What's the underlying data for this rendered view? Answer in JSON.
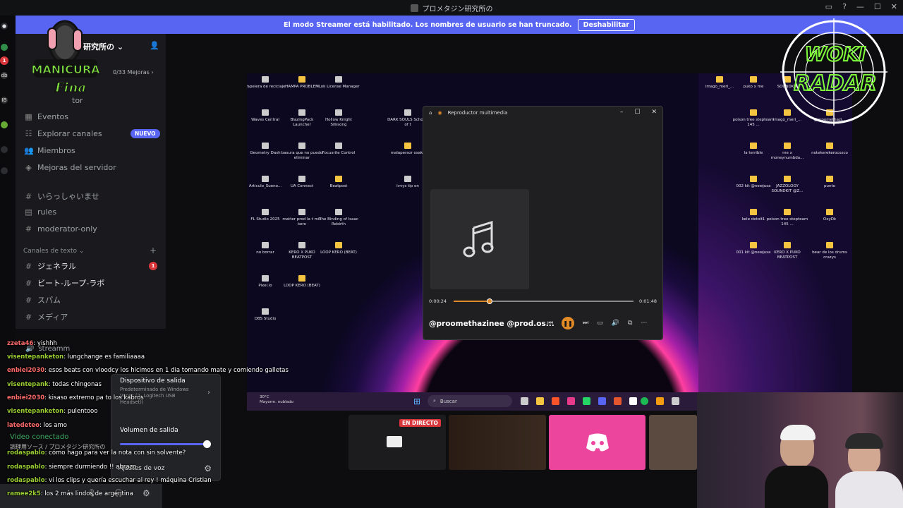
{
  "titlebar": {
    "title": "プロメタジン研究所の"
  },
  "banner": {
    "text": "El modo Streamer está habilitado. Los nombres de usuario se han truncado.",
    "button": "Deshabilitar"
  },
  "rail": {
    "labels": [
      "db",
      "IB"
    ],
    "badge": "1"
  },
  "sidebar": {
    "server_name": "研究所の",
    "boost": "0/33 Mejoras",
    "items": [
      {
        "label": "tor"
      },
      {
        "label": "Eventos"
      },
      {
        "label": "Explorar canales",
        "badge": "NUEVO"
      },
      {
        "label": "Miembros"
      },
      {
        "label": "Mejoras del servidor"
      },
      {
        "label": "いらっしゃいませ"
      },
      {
        "label": "rules"
      },
      {
        "label": "moderator-only"
      }
    ],
    "category": "Canales de texto",
    "text_channels": [
      {
        "label": "ジェネラル",
        "badge": "1"
      },
      {
        "label": "ビート-ループ-ラボ"
      },
      {
        "label": "スパム"
      },
      {
        "label": "メディア"
      },
      {
        "label": "streamm"
      }
    ]
  },
  "logo": {
    "line1": "MANICURA",
    "line2": "Fina"
  },
  "radar": {
    "line1": "WOKI",
    "line2": "RADAR"
  },
  "desktop": {
    "icons_left": [
      {
        "label": "Papelera de reciclaje",
        "type": "app"
      },
      {
        "label": "HAMPA PROBLEM",
        "type": "folder"
      },
      {
        "label": "iLok License Manager",
        "type": "app"
      },
      {
        "label": "Waves Central",
        "type": "app"
      },
      {
        "label": "BlazingPack Launcher",
        "type": "app"
      },
      {
        "label": "Hollow Knight Silksong",
        "type": "app"
      },
      {
        "label": "DARK SOULS Scholar of t",
        "type": "app"
      },
      {
        "label": "Geometry Dash",
        "type": "app"
      },
      {
        "label": "basura que no puedo eliminar",
        "type": "app"
      },
      {
        "label": "Focusrite Control",
        "type": "app"
      },
      {
        "label": "malapersor osaka",
        "type": "folder"
      },
      {
        "label": "Articulo_Sueno...",
        "type": "app"
      },
      {
        "label": "UA Connect",
        "type": "app"
      },
      {
        "label": "Beatpost",
        "type": "folder"
      },
      {
        "label": "ivvys tip on",
        "type": "app"
      },
      {
        "label": "FL Studio 2025",
        "type": "app"
      },
      {
        "label": "matter prod la t mix kero",
        "type": "app"
      },
      {
        "label": "The Binding of Isaac Rebirth",
        "type": "app"
      },
      {
        "label": "no borrar",
        "type": "app"
      },
      {
        "label": "KERO X PUKO BEATPOST",
        "type": "app"
      },
      {
        "label": "LOOP KERO (BEAT)",
        "type": "folder"
      },
      {
        "label": "Pixel.io",
        "type": "app"
      },
      {
        "label": "LOOP KERO (BEAT)",
        "type": "folder"
      },
      {
        "label": "OBS Studio",
        "type": "app"
      }
    ],
    "icons_right": [
      {
        "label": "imago_meri_...",
        "type": "folder"
      },
      {
        "label": "puko x me",
        "type": "folder"
      },
      {
        "label": "SOUNDKIT",
        "type": "folder"
      },
      {
        "label": "poison tree stepteam 145 ...",
        "type": "folder"
      },
      {
        "label": "imago_meri_...",
        "type": "folder"
      },
      {
        "label": "@proomethazi...",
        "type": "folder"
      },
      {
        "label": "la terrible",
        "type": "folder"
      },
      {
        "label": "me x moneynumbda...",
        "type": "folder"
      },
      {
        "label": "notekerekerocozco",
        "type": "folder"
      },
      {
        "label": "002 kit @newjusa",
        "type": "folder"
      },
      {
        "label": "JAZZOLOGY SOUNDKIT @Z...",
        "type": "folder"
      },
      {
        "label": "punto",
        "type": "folder"
      },
      {
        "label": "kele detoit1",
        "type": "folder"
      },
      {
        "label": "poison tree stepteam 145 ...",
        "type": "folder"
      },
      {
        "label": "OxyDk",
        "type": "folder"
      },
      {
        "label": "001 kit @newjusa",
        "type": "folder"
      },
      {
        "label": "KERO X PUKO BEATPOST",
        "type": "folder"
      },
      {
        "label": "bear de los drums crazys",
        "type": "folder"
      }
    ]
  },
  "player": {
    "title": "Reproductor multimedia",
    "position": "0:00:24",
    "duration": "0:01:48",
    "progress": 0.2,
    "song": "@proomethazinee @prod.os..."
  },
  "taskbar": {
    "temp": "30°C",
    "weather": "Mayorm. nublado",
    "search": "Buscar"
  },
  "stream": {
    "live_label": "EN DIRECTO"
  },
  "popup": {
    "output_title": "Dispositivo de salida",
    "output_sub": "Predeterminado de Windows Voces (2- Logitech USB Headset))",
    "volume_title": "Volumen de salida",
    "volume_level": 0.97,
    "audio_settings": "Ajustes de voz"
  },
  "chat": [
    {
      "user": "zzeta46",
      "msg": "yishhh",
      "color": "#ff6b6b"
    },
    {
      "user": "visentepanketon",
      "msg": "lungchange es familiaaaa",
      "color": "#9acd32"
    },
    {
      "user": "enbiei2030",
      "msg": "esos beats con vloodcy los hicimos en 1 dia tomando mate y comiendo galletas",
      "color": "#ff6b6b"
    },
    {
      "user": "visentepank",
      "msg": "todas chingonas",
      "color": "#9acd32"
    },
    {
      "user": "enbiei2030",
      "msg": "kisaso extremo pa to los kabros",
      "color": "#ff6b6b"
    },
    {
      "user": "visentepanketon",
      "msg": "pulentooo",
      "color": "#9acd32"
    },
    {
      "user": "latedeteo",
      "msg": "los amo",
      "color": "#ff6b6b"
    },
    {
      "user": "rodaspablo",
      "msg": "cómo hago para ver la nota con sin solvente?",
      "color": "#9acd32"
    },
    {
      "user": "rodaspablo",
      "msg": "siempre durmiendo !! abrazo",
      "color": "#9acd32"
    },
    {
      "user": "rodaspablo",
      "msg": "vi los clips y quería escuchar al rey ! máquina Cristian",
      "color": "#9acd32"
    },
    {
      "user": "ramee2k5",
      "msg": "los 2 más lindos de argentina",
      "color": "#9acd32"
    }
  ],
  "overlay_text": {
    "video": "Video conectado",
    "channel": "調理用ソース / プロメタジン研究所の"
  }
}
